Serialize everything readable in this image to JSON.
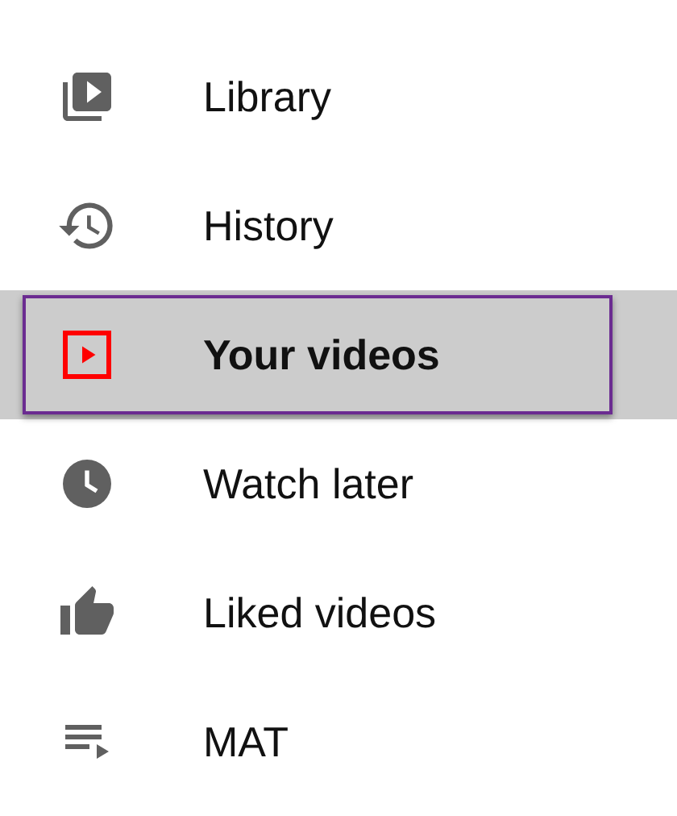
{
  "items": [
    {
      "label": "Library",
      "selected": false
    },
    {
      "label": "History",
      "selected": false
    },
    {
      "label": "Your videos",
      "selected": true
    },
    {
      "label": "Watch later",
      "selected": false
    },
    {
      "label": "Liked videos",
      "selected": false
    },
    {
      "label": "MAT",
      "selected": false
    }
  ]
}
